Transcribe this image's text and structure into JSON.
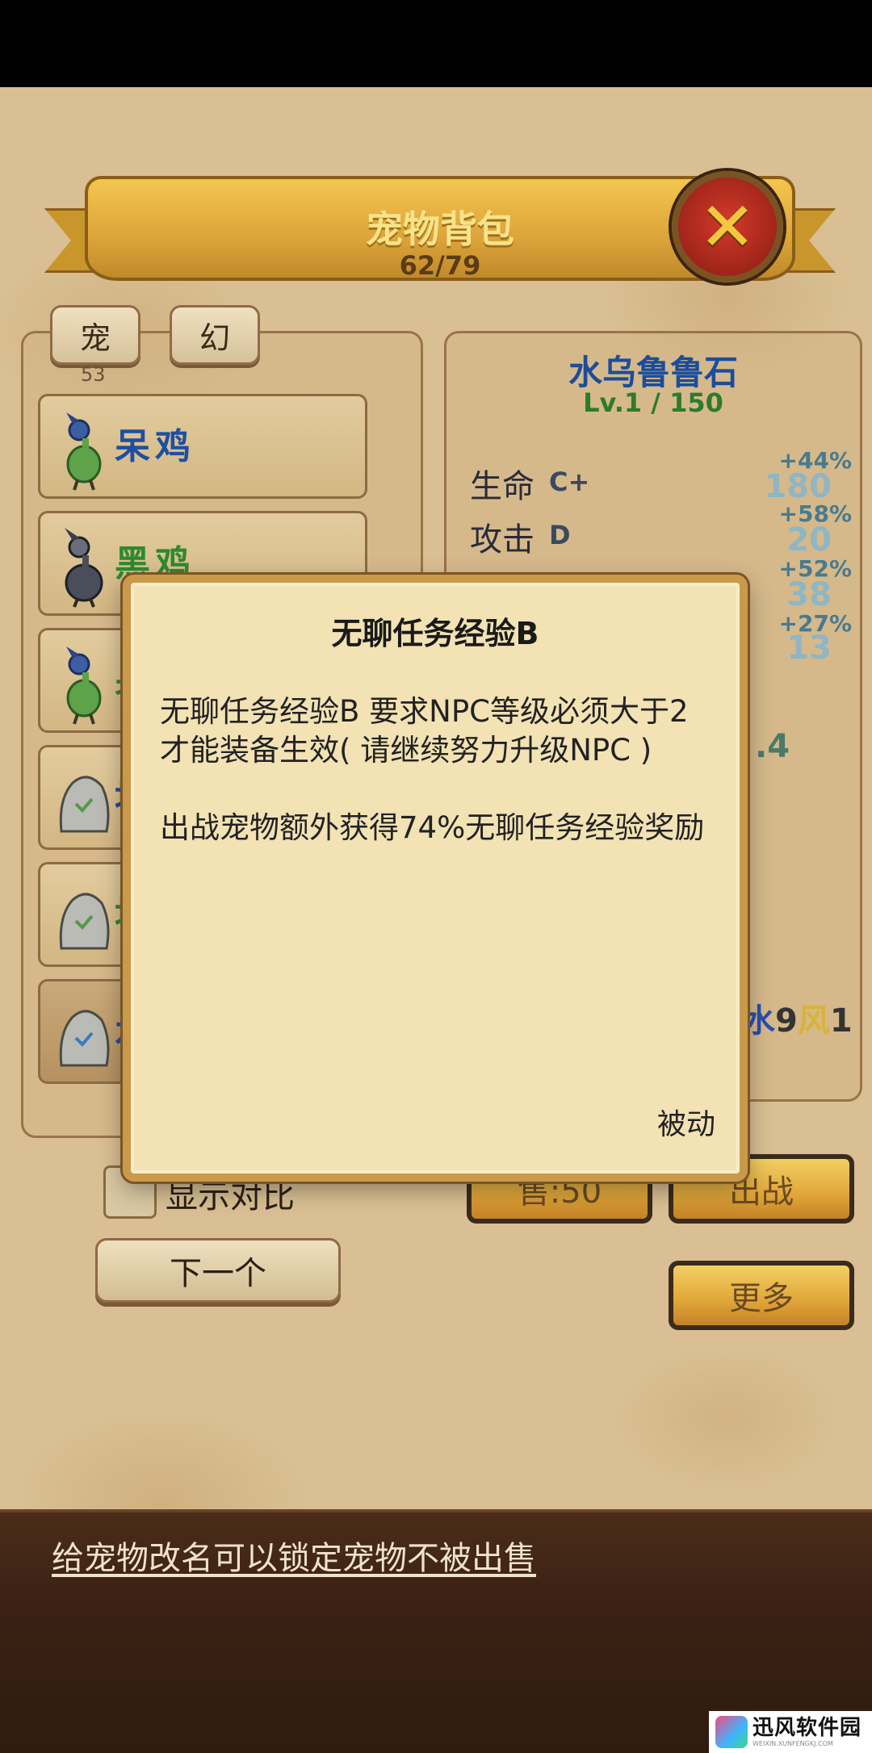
{
  "header": {
    "title": "宠物背包",
    "count": "62/79"
  },
  "tabs": [
    {
      "label": "宠"
    },
    {
      "label": "幻"
    }
  ],
  "tab_count": "53",
  "pet_list": [
    {
      "name": "呆鸡",
      "color": "#1f4fa0",
      "sprite": "green-bird-icon"
    },
    {
      "name": "黑鸡",
      "color": "#2f8a2f",
      "sprite": "dark-bird-icon"
    },
    {
      "name": "呆",
      "color": "#2f8a2f",
      "sprite": "green-bird-icon"
    },
    {
      "name": "地",
      "color": "#1f4fa0",
      "sprite": "stone-icon"
    },
    {
      "name": "地",
      "color": "#2f8a2f",
      "sprite": "stone-icon"
    },
    {
      "name": "水",
      "color": "#1f4fa0",
      "sprite": "stone-icon"
    }
  ],
  "detail": {
    "name": "水乌鲁鲁石",
    "level": "Lv.1 / 150",
    "stats": [
      {
        "label": "生命",
        "grade": "C+",
        "pct": "+44%",
        "value": "180"
      },
      {
        "label": "攻击",
        "grade": "D",
        "pct": "+58%",
        "value": "20"
      },
      {
        "label": "",
        "grade": "",
        "pct": "+52%",
        "value": "38"
      },
      {
        "label": "",
        "grade": "",
        "pct": "+27%",
        "value": "13"
      }
    ],
    "partial_value": ".4",
    "elements": {
      "e1": "水",
      "n1": "9",
      "e2": "风",
      "n2": "1"
    }
  },
  "controls": {
    "compare_label": "显示对比",
    "next_label": "下一个",
    "sell_label": "售:50",
    "battle_label": "出战",
    "more_label": "更多"
  },
  "tip": "给宠物改名可以锁定宠物不被出售",
  "dialog": {
    "title": "无聊任务经验B",
    "para1": "无聊任务经验B 要求NPC等级必须大于2 才能装备生效( 请继续努力升级NPC )",
    "para2": "出战宠物额外获得74%无聊任务经验奖励",
    "tag": "被动"
  },
  "watermark": {
    "name": "迅风软件园",
    "url": "WEIXIN.XUNFENGKJ.COM"
  }
}
